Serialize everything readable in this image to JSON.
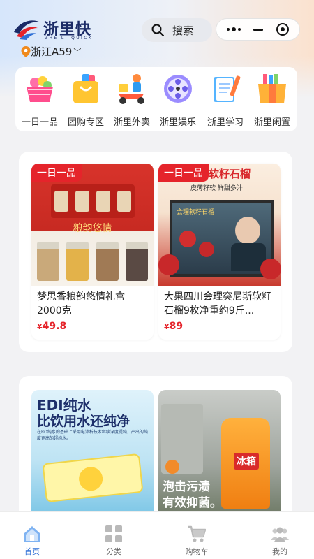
{
  "header": {
    "brand": "浙里快",
    "brand_sub": "ZHE LI QUICK",
    "search_label": "搜索",
    "location": "浙江A59"
  },
  "categories": [
    {
      "label": "一日一品",
      "icon": "shopping-basket-icon"
    },
    {
      "label": "团购专区",
      "icon": "shopping-bag-icon"
    },
    {
      "label": "浙里外卖",
      "icon": "delivery-scooter-icon"
    },
    {
      "label": "浙里娱乐",
      "icon": "film-reel-icon"
    },
    {
      "label": "浙里学习",
      "icon": "notebook-icon"
    },
    {
      "label": "浙里闲置",
      "icon": "gift-box-icon"
    }
  ],
  "products": [
    {
      "tag": "一日一品",
      "name": "梦思香粮韵悠情礼盒2000克",
      "currency": "¥",
      "price": "49.8",
      "banner": "粮韵悠情"
    },
    {
      "tag": "一日一品",
      "name": "大果四川会理突尼斯软籽石榴9枚净重约9斤...",
      "currency": "¥",
      "price": "89",
      "banner": "软籽石榴",
      "sub": "皮薄籽软 鲜甜多汁",
      "poster": "会理软籽石榴"
    }
  ],
  "ads": [
    {
      "line1": "EDI纯水",
      "line2": "比饮用水还纯净",
      "small": "在RO纯水的基础上采用电渗析技术继续深度提纯，产出的纯度更高的超纯水。"
    },
    {
      "line1": "泡击污渍",
      "line2": "有效抑菌。",
      "badge": "冰箱"
    }
  ],
  "tabbar": [
    {
      "label": "首页",
      "icon": "home-icon",
      "active": true
    },
    {
      "label": "分类",
      "icon": "grid-icon",
      "active": false
    },
    {
      "label": "购物车",
      "icon": "cart-icon",
      "active": false
    },
    {
      "label": "我的",
      "icon": "user-group-icon",
      "active": false
    }
  ],
  "colors": {
    "accent": "#e5242b",
    "brand": "#1a2a66",
    "tab_active": "#2e6fd6"
  }
}
